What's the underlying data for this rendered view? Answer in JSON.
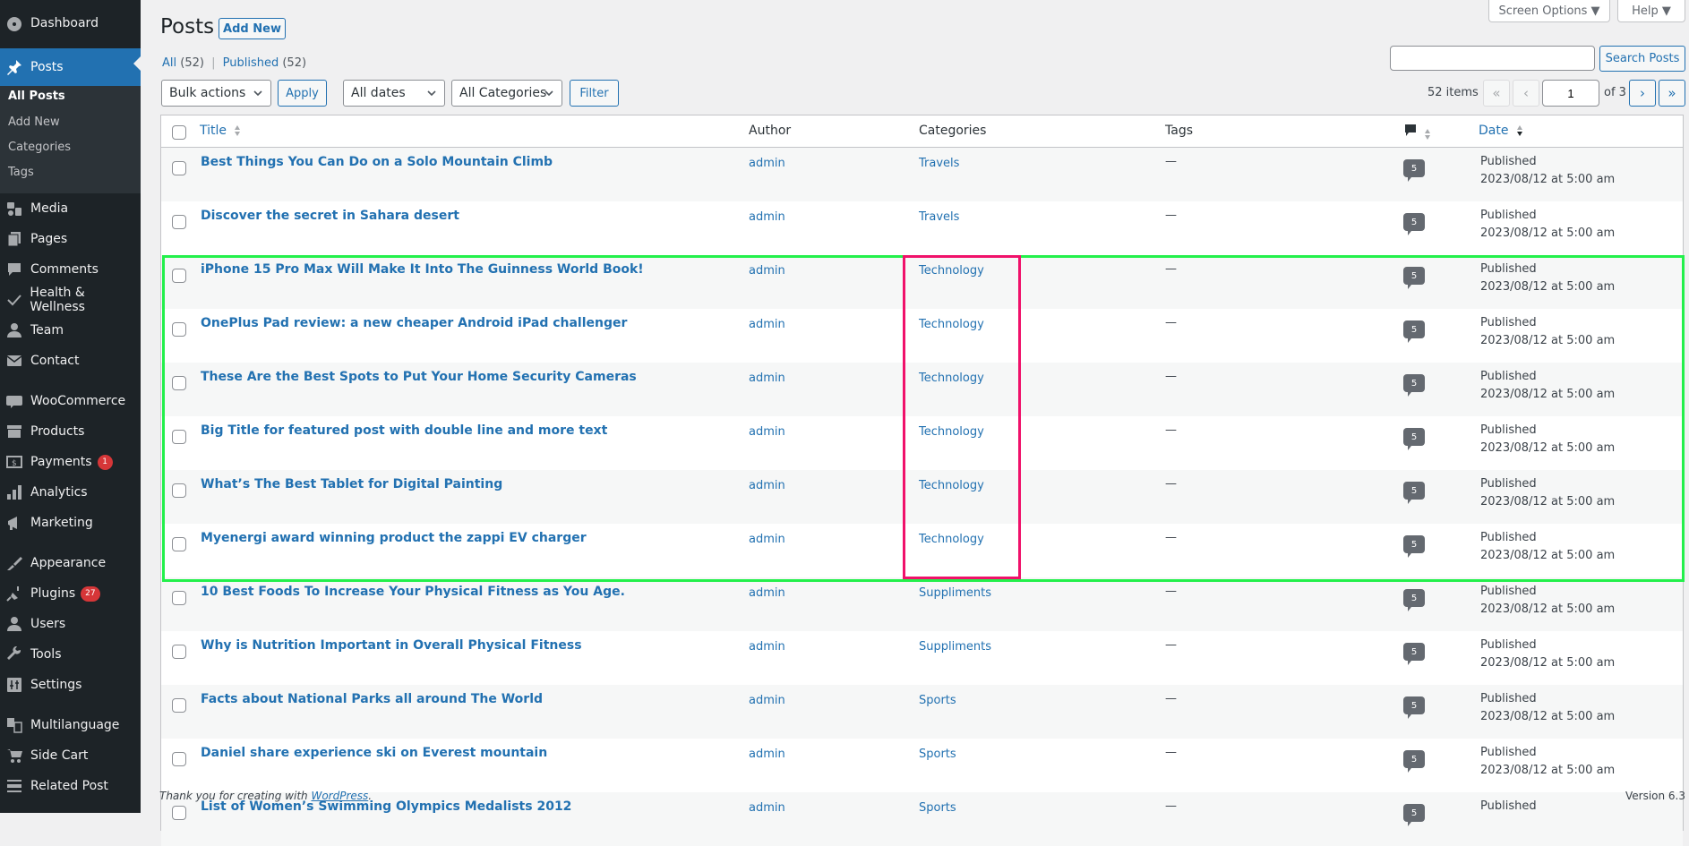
{
  "sidebar": {
    "items": [
      {
        "label": "Dashboard",
        "icon": "dashboard-icon"
      },
      {
        "label": "Posts",
        "icon": "pin-icon",
        "active": true
      },
      {
        "label": "Media",
        "icon": "media-icon"
      },
      {
        "label": "Pages",
        "icon": "pages-icon"
      },
      {
        "label": "Comments",
        "icon": "comments-icon"
      },
      {
        "label": "Health & Wellness",
        "icon": "checkmark-icon"
      },
      {
        "label": "Team",
        "icon": "user-icon"
      },
      {
        "label": "Contact",
        "icon": "envelope-icon"
      },
      {
        "label": "WooCommerce",
        "icon": "woo-icon"
      },
      {
        "label": "Products",
        "icon": "archive-icon"
      },
      {
        "label": "Payments",
        "icon": "payments-icon",
        "badge": "1"
      },
      {
        "label": "Analytics",
        "icon": "bar-chart-icon"
      },
      {
        "label": "Marketing",
        "icon": "megaphone-icon"
      },
      {
        "label": "Appearance",
        "icon": "paintbrush-icon"
      },
      {
        "label": "Plugins",
        "icon": "plugin-icon",
        "badge": "27"
      },
      {
        "label": "Users",
        "icon": "users-icon"
      },
      {
        "label": "Tools",
        "icon": "wrench-icon"
      },
      {
        "label": "Settings",
        "icon": "settings-icon"
      },
      {
        "label": "Multilanguage",
        "icon": "translate-icon"
      },
      {
        "label": "Side Cart",
        "icon": "cart-icon"
      },
      {
        "label": "Related Post",
        "icon": "list-icon"
      }
    ],
    "submenu": [
      {
        "label": "All Posts",
        "current": true
      },
      {
        "label": "Add New"
      },
      {
        "label": "Categories"
      },
      {
        "label": "Tags"
      }
    ]
  },
  "header": {
    "title": "Posts",
    "add_new": "Add New",
    "screen_options": "Screen Options ▼",
    "help": "Help ▼"
  },
  "views": {
    "all": "All",
    "all_count": "(52)",
    "separator": "|",
    "published": "Published",
    "published_count": "(52)"
  },
  "search": {
    "value": "",
    "button": "Search Posts"
  },
  "filters": {
    "bulk_actions": "Bulk actions",
    "apply": "Apply",
    "dates": "All dates",
    "categories": "All Categories",
    "filter": "Filter"
  },
  "pagination": {
    "items": "52 items",
    "first": "«",
    "prev": "‹",
    "current": "1",
    "of": "of 3",
    "next": "›",
    "last": "»"
  },
  "table": {
    "columns": {
      "title": "Title",
      "author": "Author",
      "categories": "Categories",
      "tags": "Tags",
      "date": "Date"
    },
    "rows": [
      {
        "title": "Best Things You Can Do on a Solo Mountain Climb",
        "author": "admin",
        "category": "Travels",
        "tags": "—",
        "comments": "5",
        "status": "Published",
        "date": "2023/08/12 at 5:00 am"
      },
      {
        "title": "Discover the secret in Sahara desert",
        "author": "admin",
        "category": "Travels",
        "tags": "—",
        "comments": "5",
        "status": "Published",
        "date": "2023/08/12 at 5:00 am"
      },
      {
        "title": "iPhone 15 Pro Max Will Make It Into The Guinness World Book!",
        "author": "admin",
        "category": "Technology",
        "tags": "—",
        "comments": "5",
        "status": "Published",
        "date": "2023/08/12 at 5:00 am"
      },
      {
        "title": "OnePlus Pad review: a new cheaper Android iPad challenger",
        "author": "admin",
        "category": "Technology",
        "tags": "—",
        "comments": "5",
        "status": "Published",
        "date": "2023/08/12 at 5:00 am"
      },
      {
        "title": "These Are the Best Spots to Put Your Home Security Cameras",
        "author": "admin",
        "category": "Technology",
        "tags": "—",
        "comments": "5",
        "status": "Published",
        "date": "2023/08/12 at 5:00 am"
      },
      {
        "title": "Big Title for featured post with double line and more text",
        "author": "admin",
        "category": "Technology",
        "tags": "—",
        "comments": "5",
        "status": "Published",
        "date": "2023/08/12 at 5:00 am"
      },
      {
        "title": "What’s The Best Tablet for Digital Painting",
        "author": "admin",
        "category": "Technology",
        "tags": "—",
        "comments": "5",
        "status": "Published",
        "date": "2023/08/12 at 5:00 am"
      },
      {
        "title": "Myenergi award winning product the zappi EV charger",
        "author": "admin",
        "category": "Technology",
        "tags": "—",
        "comments": "5",
        "status": "Published",
        "date": "2023/08/12 at 5:00 am"
      },
      {
        "title": "10 Best Foods To Increase Your Physical Fitness as You Age.",
        "author": "admin",
        "category": "Suppliments",
        "tags": "—",
        "comments": "5",
        "status": "Published",
        "date": "2023/08/12 at 5:00 am"
      },
      {
        "title": "Why is Nutrition Important in Overall Physical Fitness",
        "author": "admin",
        "category": "Suppliments",
        "tags": "—",
        "comments": "5",
        "status": "Published",
        "date": "2023/08/12 at 5:00 am"
      },
      {
        "title": "Facts about National Parks all around The World",
        "author": "admin",
        "category": "Sports",
        "tags": "—",
        "comments": "5",
        "status": "Published",
        "date": "2023/08/12 at 5:00 am"
      },
      {
        "title": "Daniel share experience ski on Everest mountain",
        "author": "admin",
        "category": "Sports",
        "tags": "—",
        "comments": "5",
        "status": "Published",
        "date": "2023/08/12 at 5:00 am"
      },
      {
        "title": "List of Women’s Swimming Olympics Medalists 2012",
        "author": "admin",
        "category": "Sports",
        "tags": "—",
        "comments": "5",
        "status": "Published",
        "date": ""
      }
    ]
  },
  "footer": {
    "thanks_prefix": "Thank you for creating with ",
    "thanks_link": "WordPress",
    "thanks_suffix": ".",
    "version": "Version 6.3"
  },
  "colors": {
    "accent": "#2271b1",
    "sidebar_bg": "#1d2327",
    "badge": "#d63638",
    "highlight_green": "#23f04b",
    "highlight_pink": "#f0116a"
  }
}
